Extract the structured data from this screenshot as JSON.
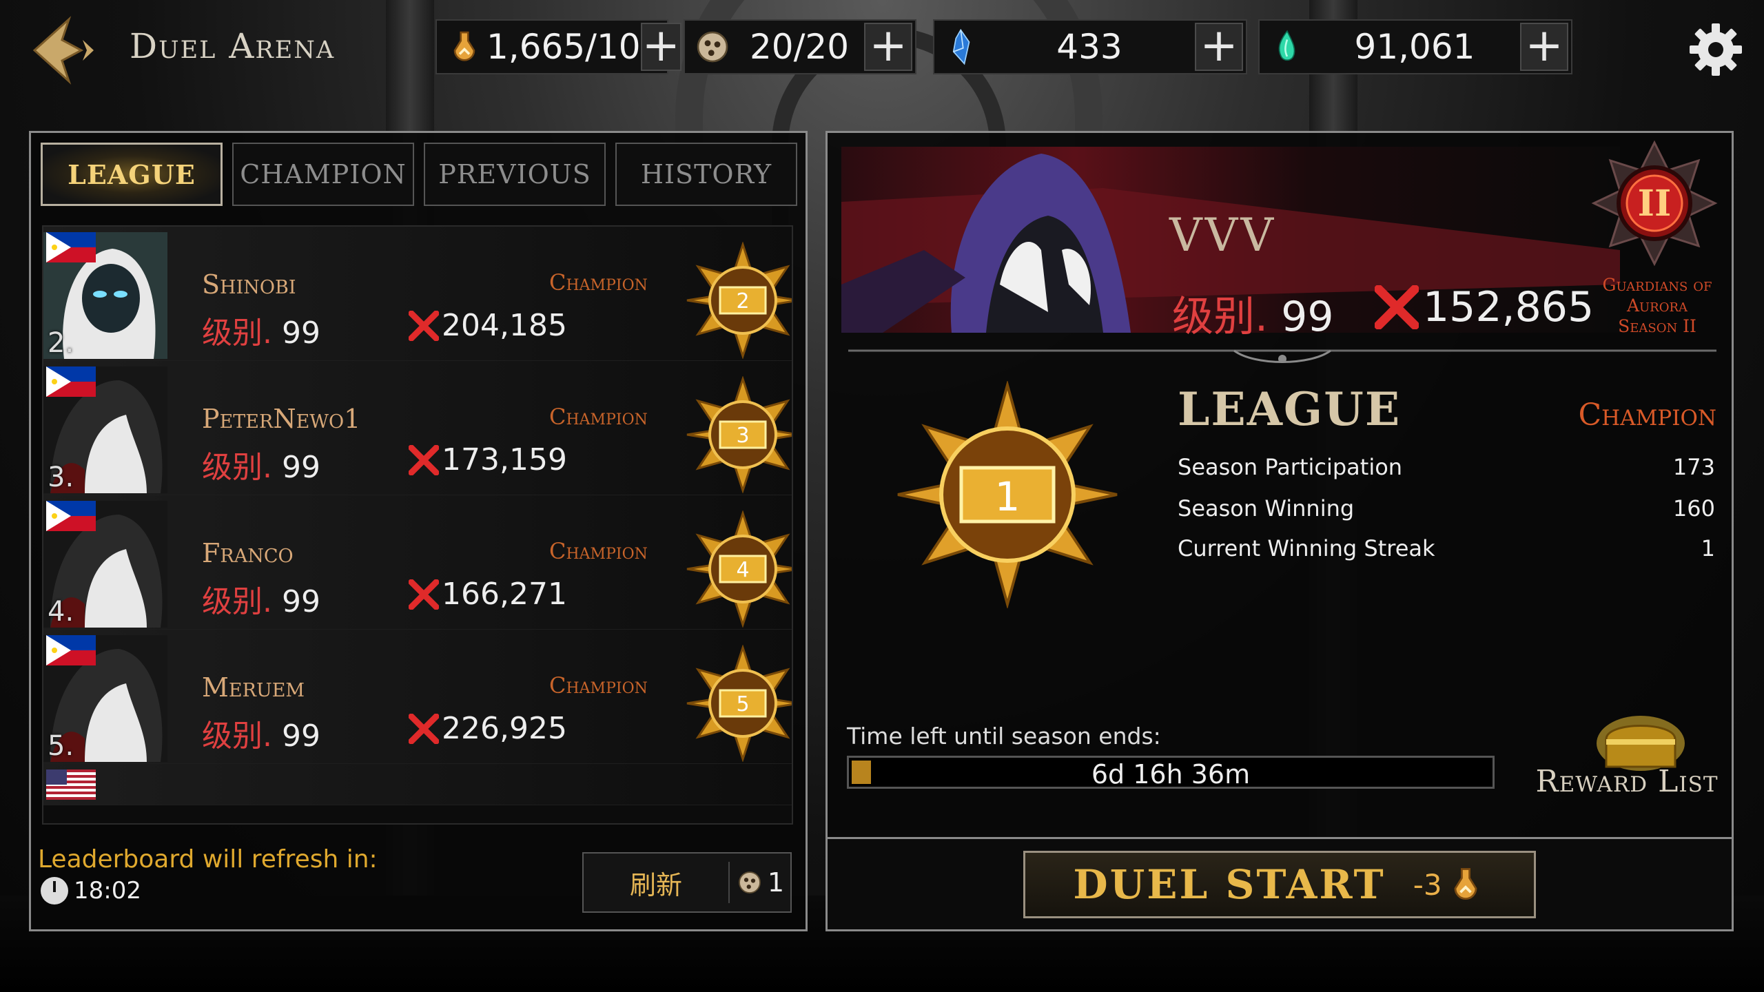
{
  "header": {
    "title": "Duel Arena",
    "resources": [
      {
        "icon": "stamina-potion-icon",
        "value": "1,665/10"
      },
      {
        "icon": "duel-ticket-icon",
        "value": "20/20"
      },
      {
        "icon": "blue-crystal-icon",
        "value": "433"
      },
      {
        "icon": "green-soul-icon",
        "value": "91,061"
      }
    ],
    "plus_label": "+"
  },
  "tabs": [
    {
      "label": "LEAGUE",
      "active": true
    },
    {
      "label": "CHAMPION",
      "active": false
    },
    {
      "label": "PREVIOUS",
      "active": false
    },
    {
      "label": "HISTORY",
      "active": false
    }
  ],
  "leaderboard": {
    "level_label": "级别.",
    "rows": [
      {
        "rank": "2.",
        "flag": "ph",
        "name": "Shinobi",
        "tier": "Champion",
        "level": "99",
        "power": "204,185",
        "badge": "2"
      },
      {
        "rank": "3.",
        "flag": "ph",
        "name": "PeterNewo1",
        "tier": "Champion",
        "level": "99",
        "power": "173,159",
        "badge": "3"
      },
      {
        "rank": "4.",
        "flag": "ph",
        "name": "Franco",
        "tier": "Champion",
        "level": "99",
        "power": "166,271",
        "badge": "4"
      },
      {
        "rank": "5.",
        "flag": "ph",
        "name": "Meruem",
        "tier": "Champion",
        "level": "99",
        "power": "226,925",
        "badge": "5"
      }
    ],
    "refresh_label": "Leaderboard will refresh in:",
    "refresh_time": "18:02",
    "refresh_button": "刷新",
    "refresh_cost": "1"
  },
  "player": {
    "name": "VVV",
    "level_label": "级别.",
    "level": "99",
    "power": "152,865",
    "season": {
      "emblem_numeral": "II",
      "line1": "Guardians of",
      "line2": "Aurora",
      "line3": "Season II"
    }
  },
  "league": {
    "title": "LEAGUE",
    "tier": "Champion",
    "rank_badge": "1",
    "stats": [
      {
        "label": "Season Participation",
        "value": "173"
      },
      {
        "label": "Season Winning",
        "value": "160"
      },
      {
        "label": "Current Winning Streak",
        "value": "1"
      }
    ]
  },
  "season_timer": {
    "label": "Time left until season ends:",
    "value": "6d 16h 36m",
    "progress_fraction": 0.03
  },
  "reward": {
    "label": "Reward List"
  },
  "duel": {
    "label": "DUEL START",
    "cost": "-3"
  },
  "colors": {
    "accent_gold": "#e8b84a",
    "level_red": "#e04040",
    "tier_orange": "#c8642a"
  }
}
